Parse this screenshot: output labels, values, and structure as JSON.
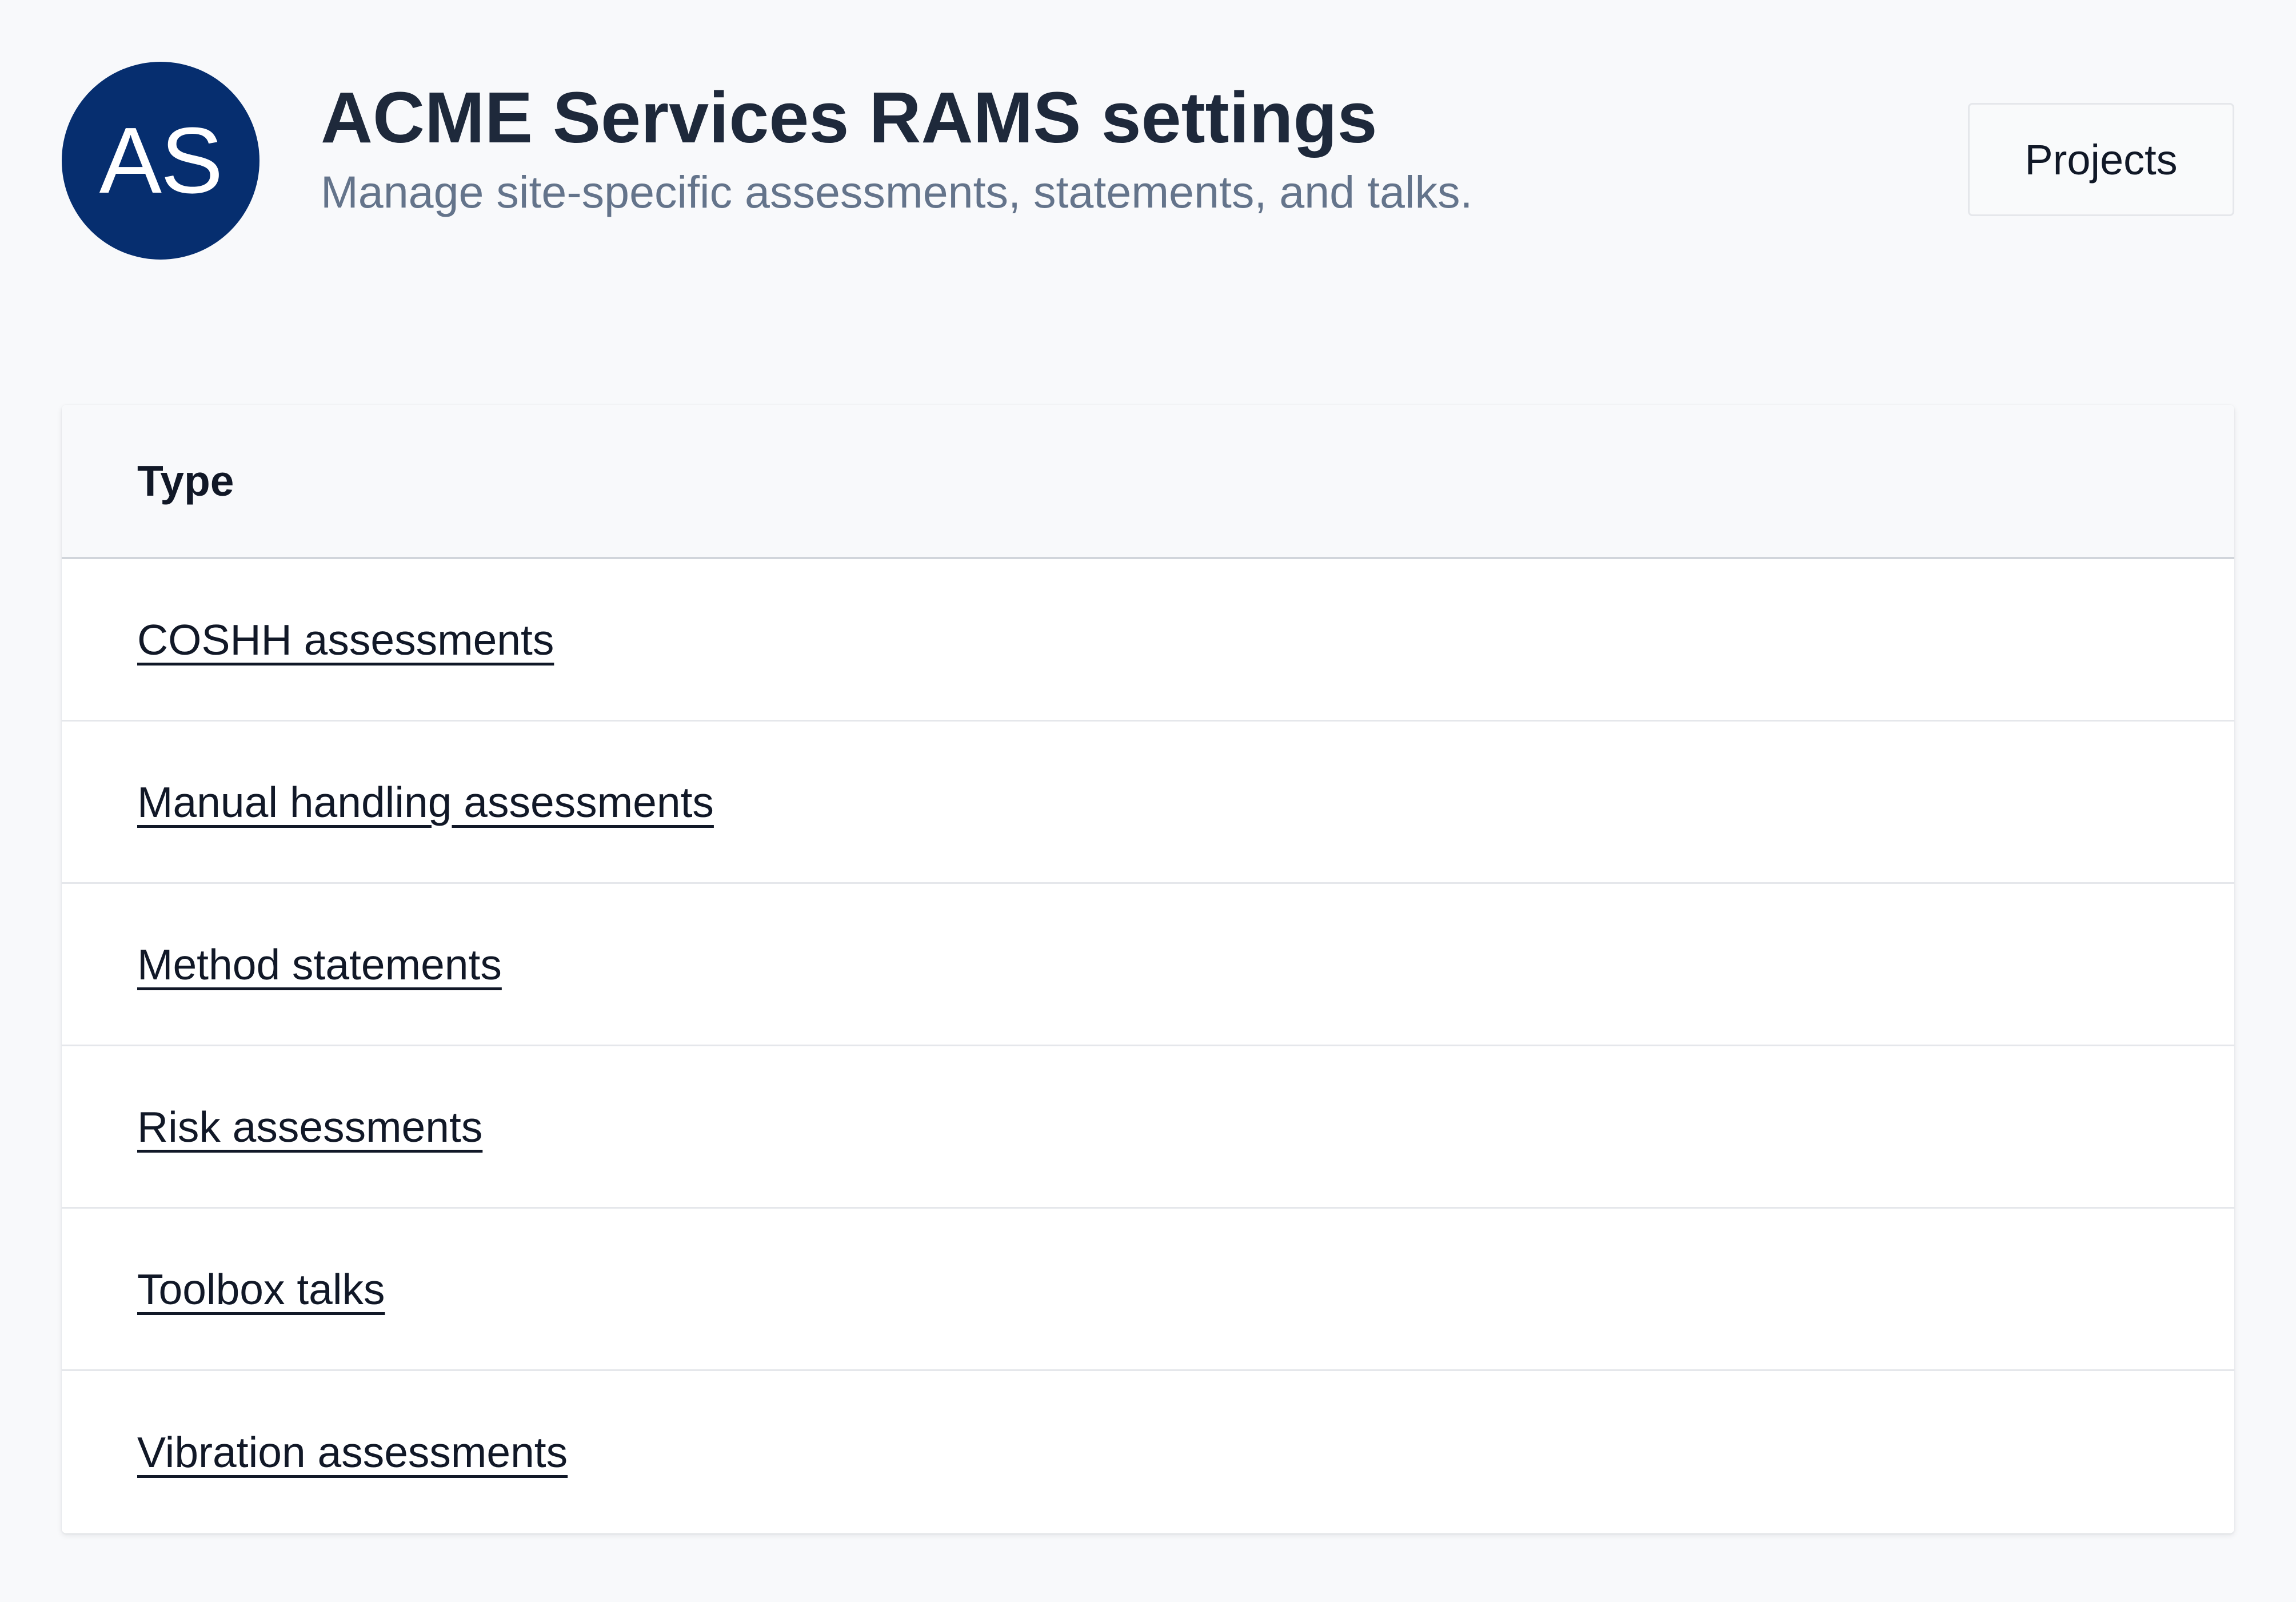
{
  "header": {
    "avatar_initials": "AS",
    "title": "ACME Services RAMS settings",
    "subtitle": "Manage site-specific assessments, statements, and talks.",
    "projects_button": "Projects"
  },
  "table": {
    "column_header": "Type",
    "rows": [
      {
        "label": "COSHH assessments"
      },
      {
        "label": "Manual handling assessments"
      },
      {
        "label": "Method statements"
      },
      {
        "label": "Risk assessments"
      },
      {
        "label": "Toolbox talks"
      },
      {
        "label": "Vibration assessments"
      }
    ]
  },
  "colors": {
    "avatar_background": "#062e6f",
    "page_background": "#f8f9fb",
    "subtitle_text": "#64748b"
  }
}
